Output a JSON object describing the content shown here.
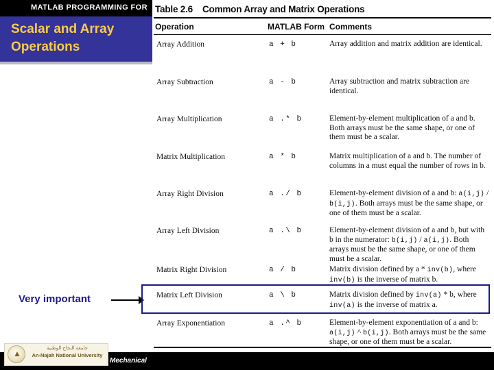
{
  "slide": {
    "banner_text": "MATLAB PROGRAMMING FOR",
    "title": "Scalar and Array Operations",
    "department": "Mechanical",
    "logo": {
      "arabic": "جامعة النجاح الوطنية",
      "english": "An-Najah National University",
      "bird_glyph": "ὔ"
    },
    "annotation": {
      "label": "Very important"
    },
    "colors": {
      "banner": "#000000",
      "title_bg": "#333399",
      "title_fg": "#ffcc44",
      "annotation": "#1a1a8c",
      "highlight_border": "#1a1a8c"
    }
  },
  "table": {
    "caption_number": "Table 2.6",
    "caption_title": "Common Array and Matrix Operations",
    "columns": [
      "Operation",
      "MATLAB Form",
      "Comments"
    ],
    "rows": [
      {
        "operation": "Array Addition",
        "form": "a + b",
        "comment": "Array addition and matrix addition are identical."
      },
      {
        "operation": "Array Subtraction",
        "form": "a - b",
        "comment": "Array subtraction and matrix subtraction are identical."
      },
      {
        "operation": "Array Multiplication",
        "form": "a .* b",
        "comment": "Element-by-element multiplication of a and b. Both arrays must be the same shape, or one of them must be a scalar."
      },
      {
        "operation": "Matrix Multiplication",
        "form": "a * b",
        "comment": "Matrix multiplication of a and b. The number of columns in a must equal the number of rows in b."
      },
      {
        "operation": "Array Right Division",
        "form": "a ./ b",
        "comment": "Element-by-element division of a and b: a(i,j) / b(i,j). Both arrays must be the same shape, or one of them must be a scalar."
      },
      {
        "operation": "Array Left Division",
        "form": "a .\\ b",
        "comment": "Element-by-element division of a and b, but with b in the numerator: b(i,j) / a(i,j). Both arrays must be the same shape, or one of them must be a scalar."
      },
      {
        "operation": "Matrix Right Division",
        "form": "a / b",
        "comment": "Matrix division defined by a * inv(b), where inv(b) is the inverse of matrix b."
      },
      {
        "operation": "Matrix Left Division",
        "form": "a \\ b",
        "comment": "Matrix division defined by inv(a) * b, where inv(a) is the inverse of matrix a."
      },
      {
        "operation": "Array Exponentiation",
        "form": "a .^ b",
        "comment": "Element-by-element exponentiation of a and b: a(i,j) ^ b(i,j). Both arrays must be the same shape, or one of them must be a scalar."
      }
    ]
  }
}
